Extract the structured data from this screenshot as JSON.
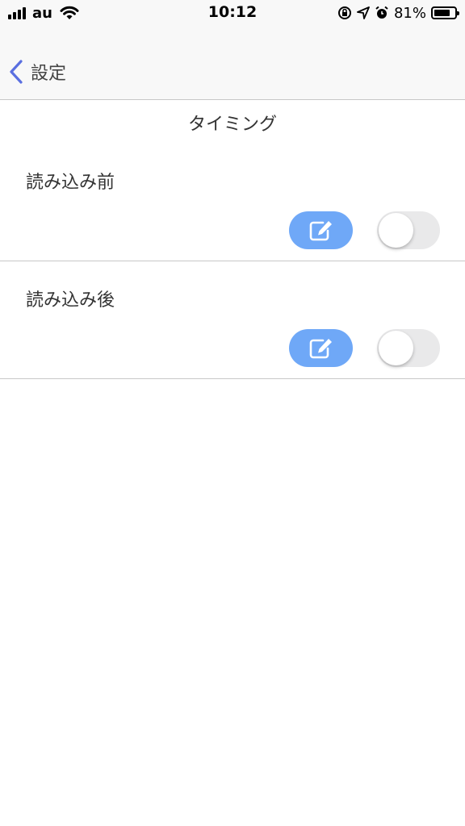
{
  "status_bar": {
    "carrier": "au",
    "time": "10:12",
    "battery_percent": "81%",
    "battery_level": 0.81
  },
  "nav": {
    "back_label": "設定"
  },
  "section": {
    "title": "タイミング"
  },
  "rows": [
    {
      "label": "読み込み前",
      "toggle_on": false
    },
    {
      "label": "読み込み後",
      "toggle_on": false
    }
  ],
  "colors": {
    "accent": "#5a6fe0",
    "edit_button": "#6fa8f7",
    "toggle_off": "#e9e9ea"
  },
  "icons": {
    "edit": "pencil-square-icon",
    "back": "chevron-left-icon"
  }
}
